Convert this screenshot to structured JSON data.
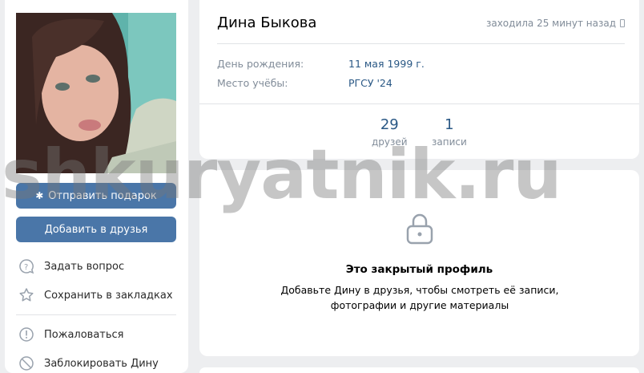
{
  "profile": {
    "name": "Дина Быкова",
    "last_seen": "заходила 25 минут назад",
    "birthday_label": "День рождения:",
    "birthday_value": "11 мая 1999 г.",
    "education_label": "Место учёбы:",
    "education_value": "РГСУ '24",
    "counters": [
      {
        "value": "29",
        "label": "друзей"
      },
      {
        "value": "1",
        "label": "записи"
      }
    ]
  },
  "actions": {
    "gift": "Отправить подарок",
    "add_friend": "Добавить в друзья"
  },
  "menu": {
    "ask": "Задать вопрос",
    "bookmark": "Сохранить в закладках",
    "report": "Пожаловаться",
    "block": "Заблокировать Дину"
  },
  "closed": {
    "title": "Это закрытый профиль",
    "desc_line1": "Добавьте Дину в друзья, чтобы смотреть её записи,",
    "desc_line2": "фотографии и другие материалы"
  },
  "watermark": "shkuryatnik.ru",
  "colors": {
    "accent": "#4a76a8",
    "link": "#2a5885",
    "muted": "#818c99"
  }
}
